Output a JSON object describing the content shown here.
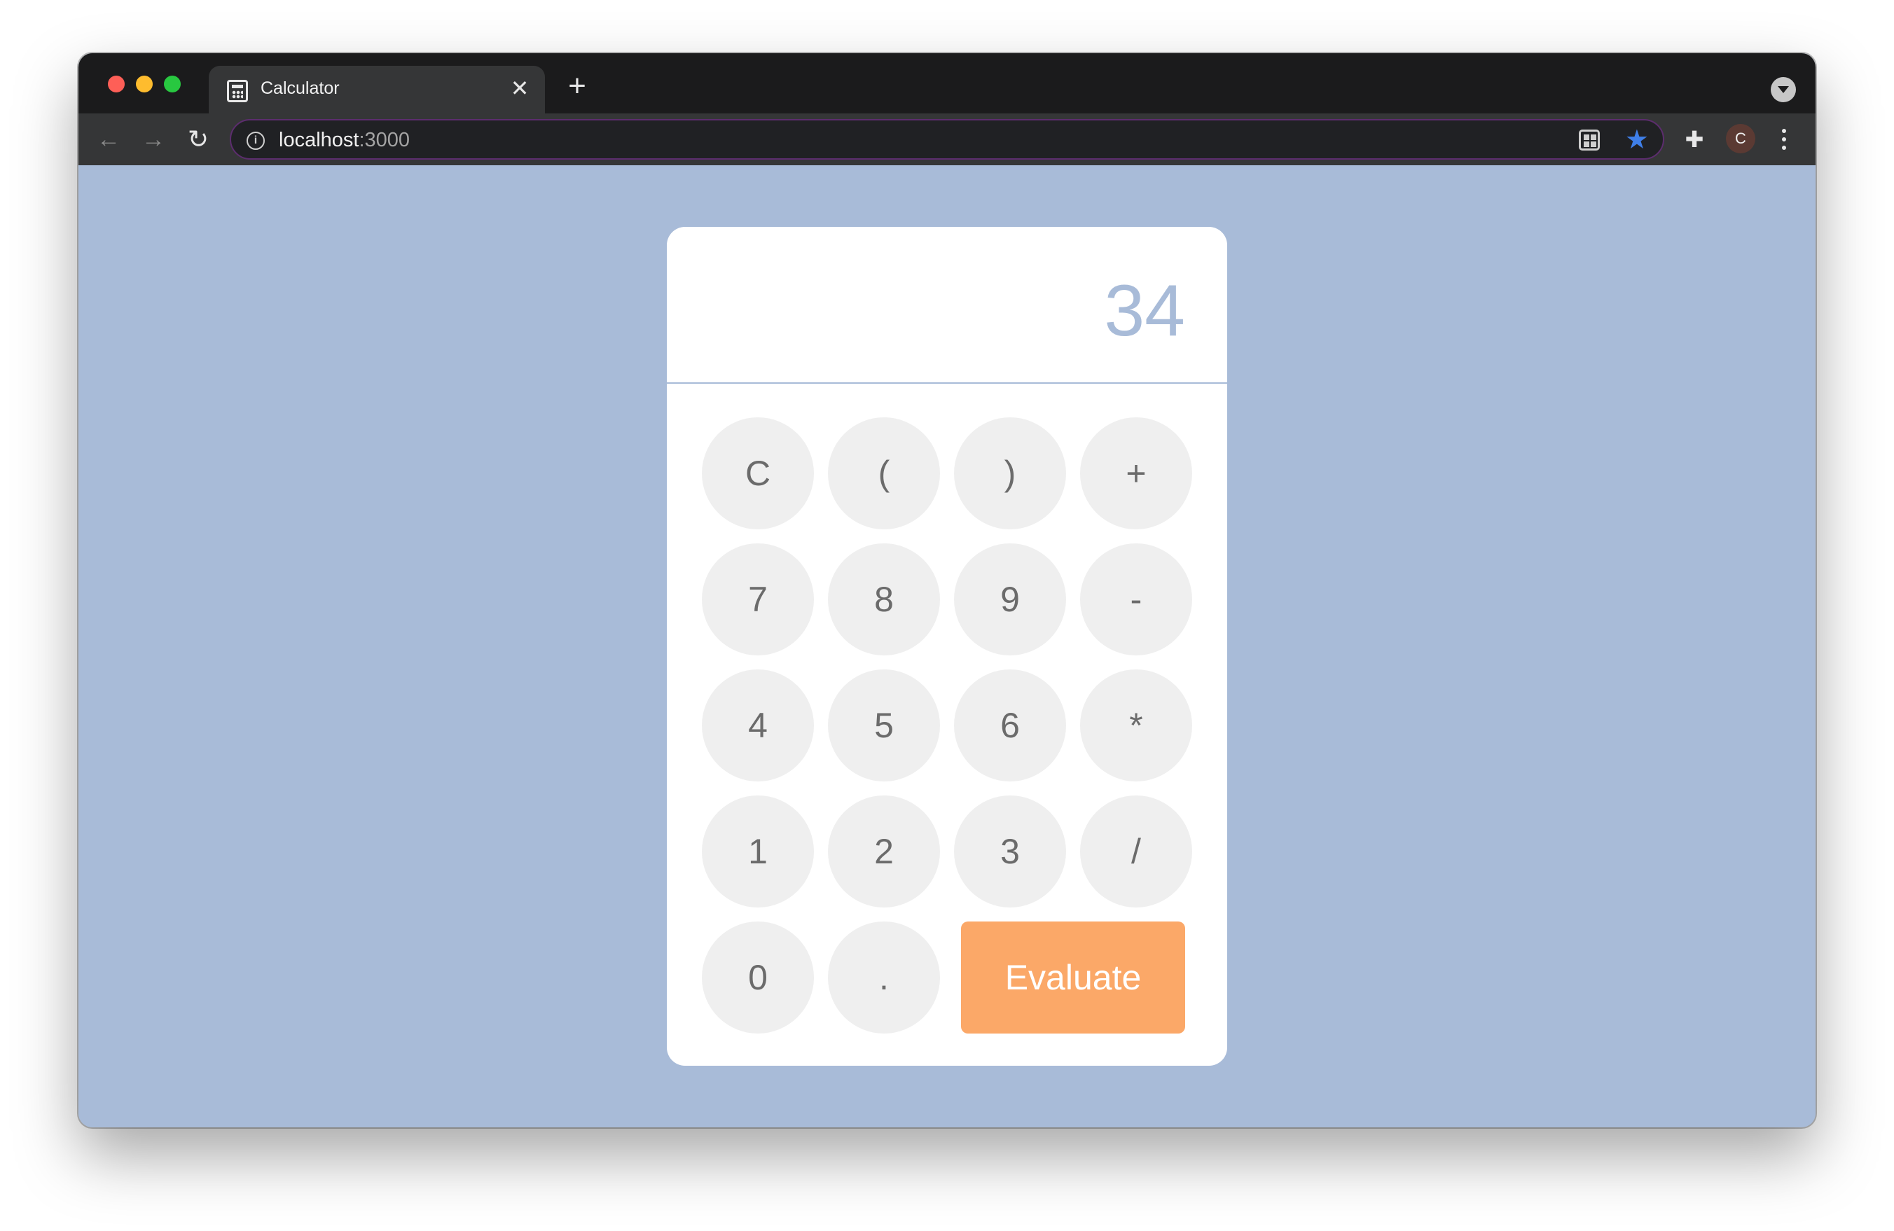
{
  "browser": {
    "tab_title": "Calculator",
    "tab_close": "✕",
    "new_tab": "+",
    "url_host": "localhost",
    "url_port": ":3000",
    "avatar_initial": "C",
    "back": "←",
    "forward": "→",
    "reload": "↻",
    "star": "★",
    "extensions": "✚",
    "info": "i"
  },
  "calculator": {
    "display": "34",
    "keys": [
      "C",
      "(",
      ")",
      "+",
      "7",
      "8",
      "9",
      "-",
      "4",
      "5",
      "6",
      "*",
      "1",
      "2",
      "3",
      "/",
      "0",
      "."
    ],
    "evaluate_label": "Evaluate"
  },
  "colors": {
    "page_background": "#a8bbd8",
    "key_background": "#efefef",
    "evaluate_background": "#fba868",
    "display_text": "#a8bbd8"
  }
}
